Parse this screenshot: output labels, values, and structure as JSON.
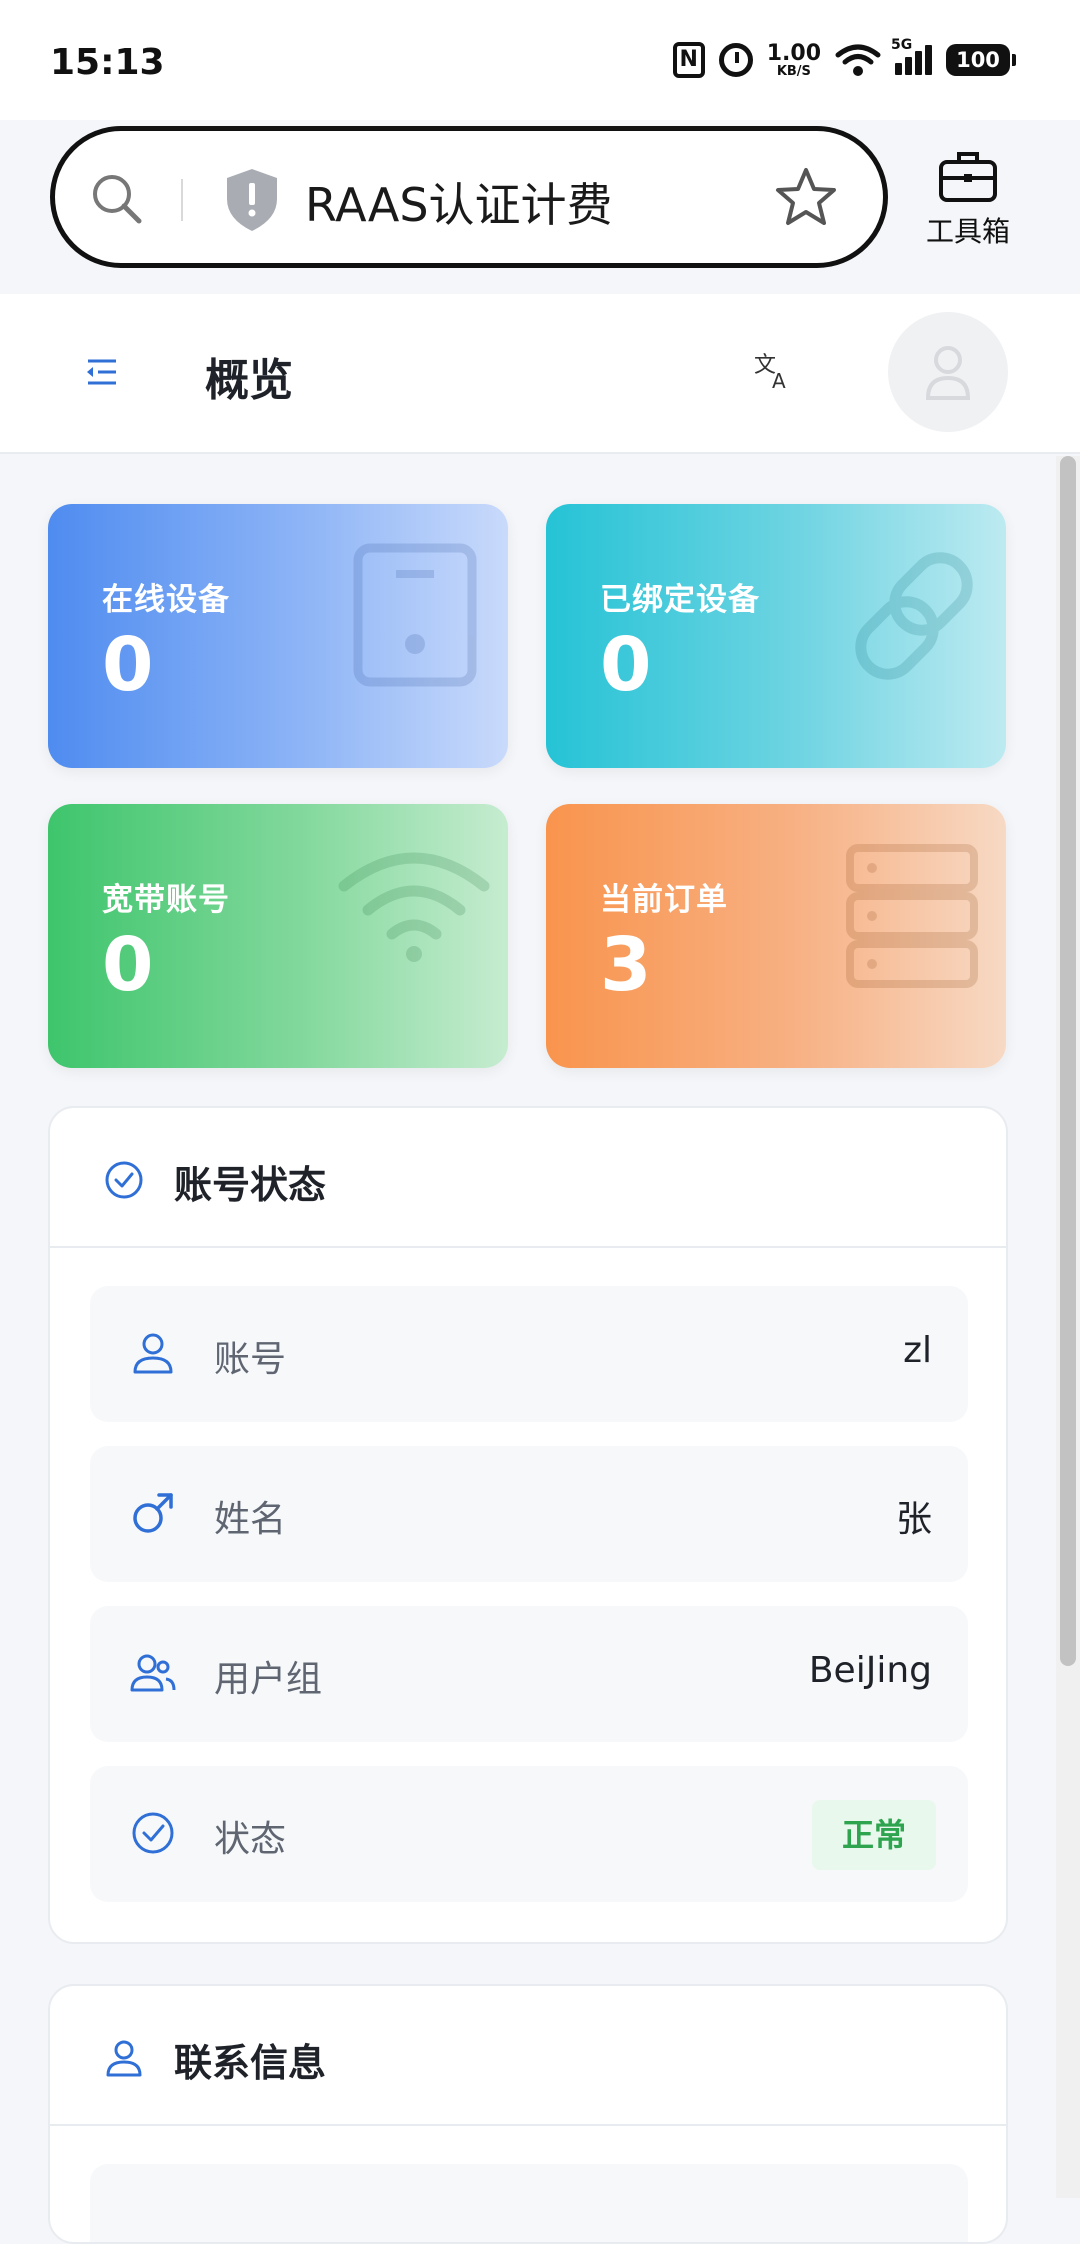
{
  "status_bar": {
    "time": "15:13",
    "nfc": "N",
    "speed_value": "1.00",
    "speed_unit": "KB/S",
    "network": "5G",
    "battery": "100"
  },
  "browser": {
    "url_title": "RAAS认证计费",
    "toolbox_label": "工具箱"
  },
  "header": {
    "title": "概览"
  },
  "stats": [
    {
      "label": "在线设备",
      "value": "0",
      "icon": "tablet-icon"
    },
    {
      "label": "已绑定设备",
      "value": "0",
      "icon": "link-icon"
    },
    {
      "label": "宽带账号",
      "value": "0",
      "icon": "wifi-icon"
    },
    {
      "label": "当前订单",
      "value": "3",
      "icon": "server-icon"
    }
  ],
  "account_status": {
    "title": "账号状态",
    "rows": [
      {
        "label": "账号",
        "value": "zl"
      },
      {
        "label": "姓名",
        "value": "张"
      },
      {
        "label": "用户组",
        "value": "BeiJing"
      },
      {
        "label": "状态",
        "value": "正常"
      }
    ]
  },
  "contact_info": {
    "title": "联系信息"
  },
  "colors": {
    "accent": "#2f6fd6",
    "status_ok": "#2ea44f"
  }
}
